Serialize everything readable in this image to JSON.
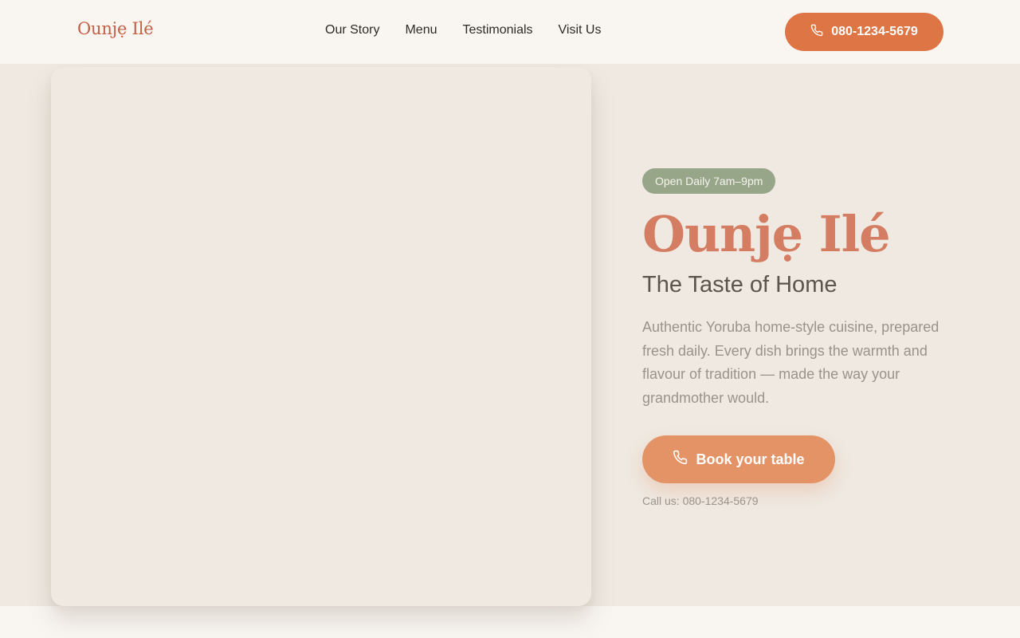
{
  "brand": {
    "logo_text": "Ounjẹ Ilé"
  },
  "nav": {
    "items": [
      {
        "label": "Our Story"
      },
      {
        "label": "Menu"
      },
      {
        "label": "Testimonials"
      },
      {
        "label": "Visit Us"
      }
    ]
  },
  "header": {
    "phone_label": "080-1234-5679",
    "phone_icon": "phone-icon"
  },
  "hero": {
    "badge": "Open Daily 7am–9pm",
    "title": "Ounjẹ Ilé",
    "subtitle": "The Taste of Home",
    "description": "Authentic Yoruba home-style cuisine, prepared fresh daily. Every dish brings the warmth and flavour of tradition — made the way your grandmother would.",
    "cta_label": "Book your table",
    "cta_icon": "phone-icon",
    "call_us": "Call us: 080-1234-5679"
  },
  "colors": {
    "accent": "#dd7545",
    "title": "#d47d62",
    "badge": "#97a589",
    "hero_bg": "#efe9e1",
    "header_bg": "#f9f6f1"
  }
}
